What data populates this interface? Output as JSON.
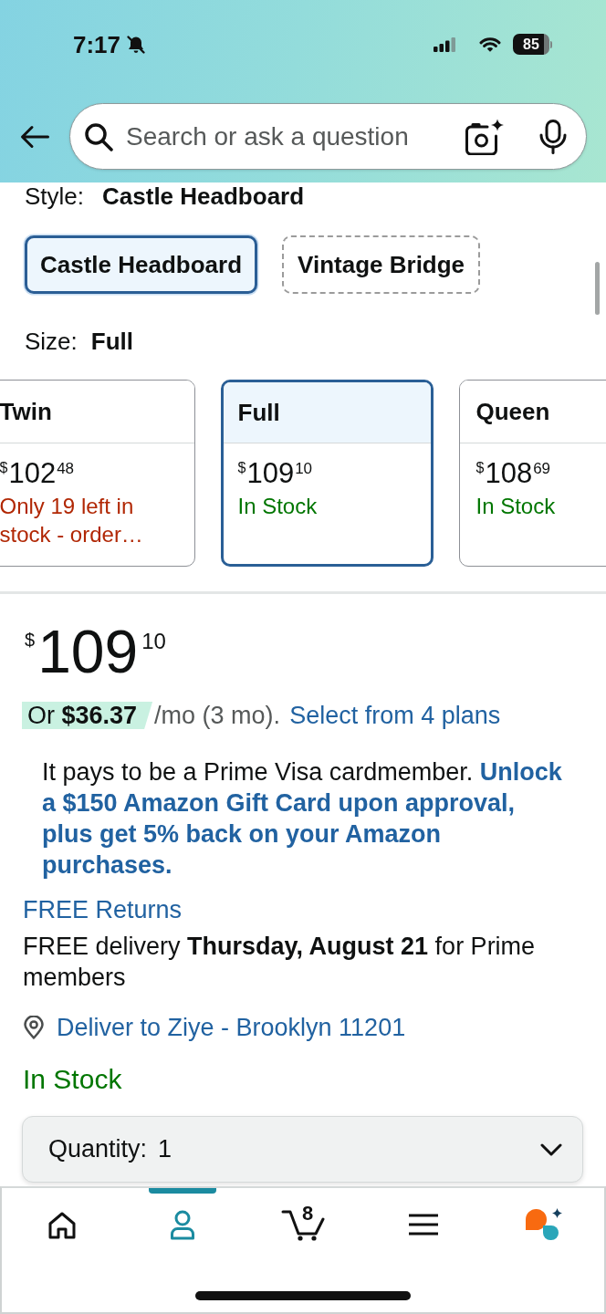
{
  "status_bar": {
    "time": "7:17",
    "silent": true,
    "battery": "85"
  },
  "search": {
    "placeholder": "Search or ask a question"
  },
  "style": {
    "label": "Style:",
    "value": "Castle Headboard",
    "options": [
      {
        "label": "Castle Headboard",
        "selected": true
      },
      {
        "label": "Vintage Bridge",
        "selected": false
      }
    ]
  },
  "size": {
    "label": "Size:",
    "value": "Full",
    "options": [
      {
        "name": "Twin",
        "price": {
          "currency": "$",
          "whole": "102",
          "fraction": "48"
        },
        "availability": "Only 19 left in stock - order…",
        "kind": "limited",
        "selected": false
      },
      {
        "name": "Full",
        "price": {
          "currency": "$",
          "whole": "109",
          "fraction": "10"
        },
        "availability": "In Stock",
        "kind": "available",
        "selected": true
      },
      {
        "name": "Queen",
        "price": {
          "currency": "$",
          "whole": "108",
          "fraction": "69"
        },
        "availability": "In Stock",
        "kind": "available",
        "selected": false
      }
    ]
  },
  "price": {
    "currency": "$",
    "whole": "109",
    "fraction": "10"
  },
  "installment": {
    "amount": "Or **$36.37**",
    "terms": "/mo (3 mo).",
    "link": "Select from 4 plans"
  },
  "card_offer": "It pays to be a Prime Visa cardmember. **Unlock a $150 Amazon Gift Card upon approval, plus get 5% back on your Amazon purchases.**",
  "returns_link": "FREE Returns",
  "delivery": "FREE delivery **Thursday, August 21** for Prime members",
  "deliver_to": "Deliver to Ziye - Brooklyn 11201",
  "availability": "In Stock",
  "quantity": {
    "label": "Quantity:",
    "value": "1"
  },
  "bottom_nav": {
    "items": [
      {
        "kind": "home",
        "selected": false
      },
      {
        "kind": "account",
        "selected": true
      },
      {
        "kind": "cart",
        "count": "8",
        "selected": false
      },
      {
        "kind": "menu",
        "selected": false
      },
      {
        "kind": "assistant",
        "selected": false
      }
    ]
  }
}
